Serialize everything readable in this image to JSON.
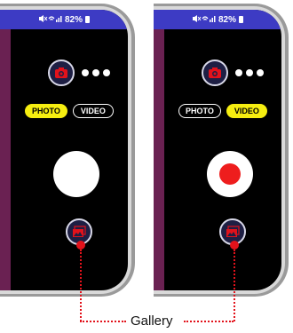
{
  "status_bar": {
    "icons": "×)≈.ıl",
    "battery_text": "82%"
  },
  "modes": {
    "photo_label": "PHOTO",
    "video_label": "VIDEO"
  },
  "callout": {
    "label": "Gallery"
  },
  "screens": [
    {
      "id": "photo-mode",
      "active_mode": "PHOTO",
      "shutter": "photo"
    },
    {
      "id": "video-mode",
      "active_mode": "VIDEO",
      "shutter": "video-record"
    }
  ],
  "colors": {
    "status_bar": "#3d3bc4",
    "active_pill": "#f6ee10",
    "record_red": "#ee1d1d",
    "callout_red": "#e2121b",
    "edge_strip": "#6a2152"
  },
  "icons": [
    "camera-switch-icon",
    "more-options-icon",
    "gallery-icon",
    "record-icon"
  ]
}
